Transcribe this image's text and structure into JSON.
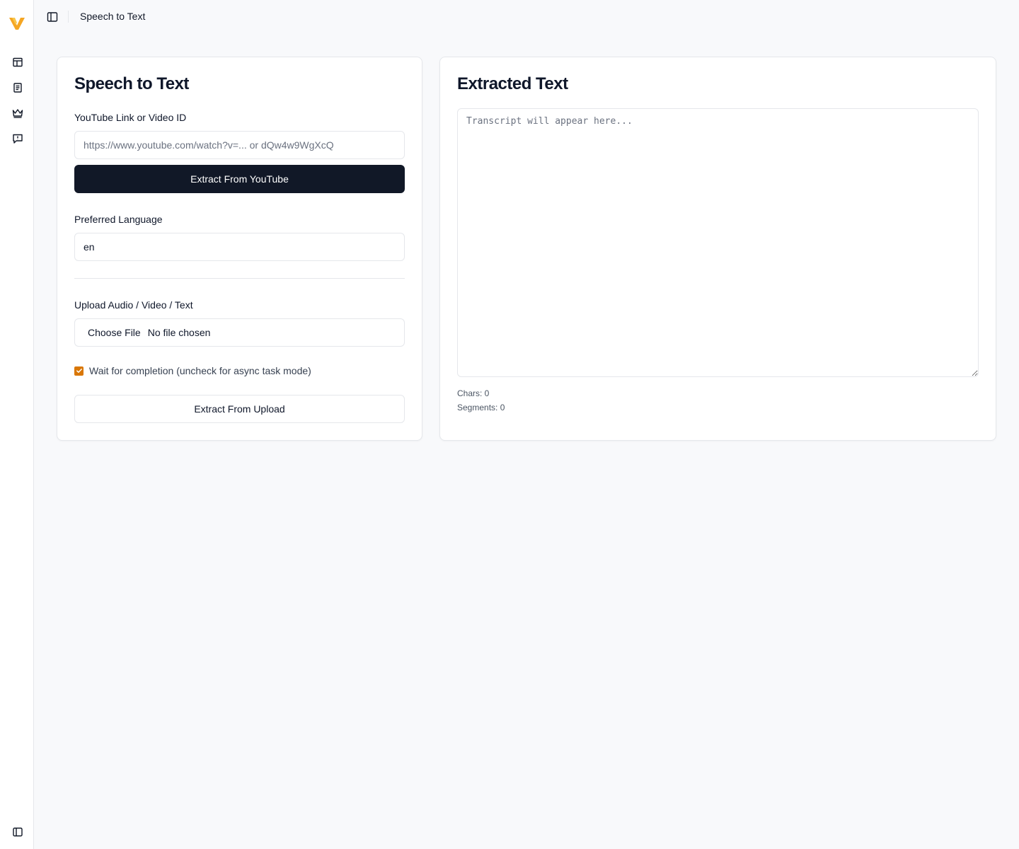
{
  "app": {
    "brand": "vm-logo",
    "accent": "#f5a623"
  },
  "sidebar": {
    "items": [
      {
        "icon": "layout-icon"
      },
      {
        "icon": "document-icon"
      },
      {
        "icon": "crown-icon"
      },
      {
        "icon": "feedback-icon"
      }
    ],
    "bottom_icon": "sidebar-toggle-icon"
  },
  "header": {
    "breadcrumb": "Speech to Text"
  },
  "left_panel": {
    "title": "Speech to Text",
    "youtube_label": "YouTube Link or Video ID",
    "youtube_placeholder": "https://www.youtube.com/watch?v=... or dQw4w9WgXcQ",
    "youtube_value": "",
    "extract_youtube_label": "Extract From YouTube",
    "language_label": "Preferred Language",
    "language_value": "en",
    "upload_label": "Upload Audio / Video / Text",
    "choose_file_label": "Choose File",
    "no_file_label": "No file chosen",
    "wait_label": "Wait for completion (uncheck for async task mode)",
    "wait_checked": true,
    "extract_upload_label": "Extract From Upload"
  },
  "right_panel": {
    "title": "Extracted Text",
    "transcript_placeholder": "Transcript will appear here...",
    "chars_label": "Chars: 0",
    "segments_label": "Segments: 0"
  },
  "colors": {
    "primary_button": "#111827",
    "checkbox": "#d97706",
    "background": "#f8f9fb"
  }
}
